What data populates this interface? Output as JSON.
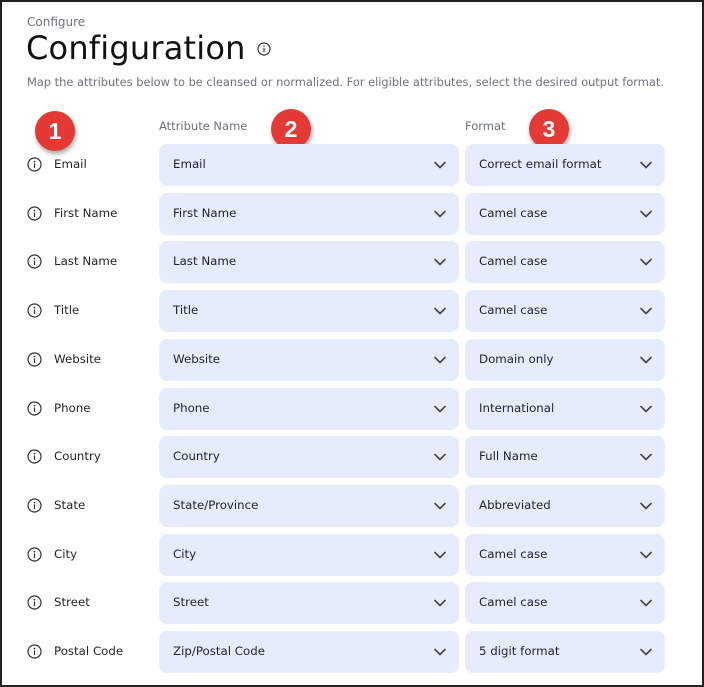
{
  "header": {
    "breadcrumb": "Configure",
    "title": "Configuration",
    "description": "Map the attributes below to be cleansed or normalized. For eligible attributes, select the desired output format."
  },
  "columns": {
    "attribute_header": "Attribute Name",
    "format_header": "Format"
  },
  "badges": [
    "1",
    "2",
    "3"
  ],
  "colors": {
    "select_bg": "#e6ecfb",
    "badge_red": "#e53935",
    "text_muted": "#6b7280"
  },
  "rows": [
    {
      "label": "Email",
      "attribute": "Email",
      "format": "Correct email format"
    },
    {
      "label": "First Name",
      "attribute": "First Name",
      "format": "Camel case"
    },
    {
      "label": "Last Name",
      "attribute": "Last Name",
      "format": "Camel case"
    },
    {
      "label": "Title",
      "attribute": "Title",
      "format": "Camel case"
    },
    {
      "label": "Website",
      "attribute": "Website",
      "format": "Domain only"
    },
    {
      "label": "Phone",
      "attribute": "Phone",
      "format": "International"
    },
    {
      "label": "Country",
      "attribute": "Country",
      "format": "Full Name"
    },
    {
      "label": "State",
      "attribute": "State/Province",
      "format": "Abbreviated"
    },
    {
      "label": "City",
      "attribute": "City",
      "format": "Camel case"
    },
    {
      "label": "Street",
      "attribute": "Street",
      "format": "Camel case"
    },
    {
      "label": "Postal Code",
      "attribute": "Zip/Postal Code",
      "format": "5 digit format"
    }
  ]
}
